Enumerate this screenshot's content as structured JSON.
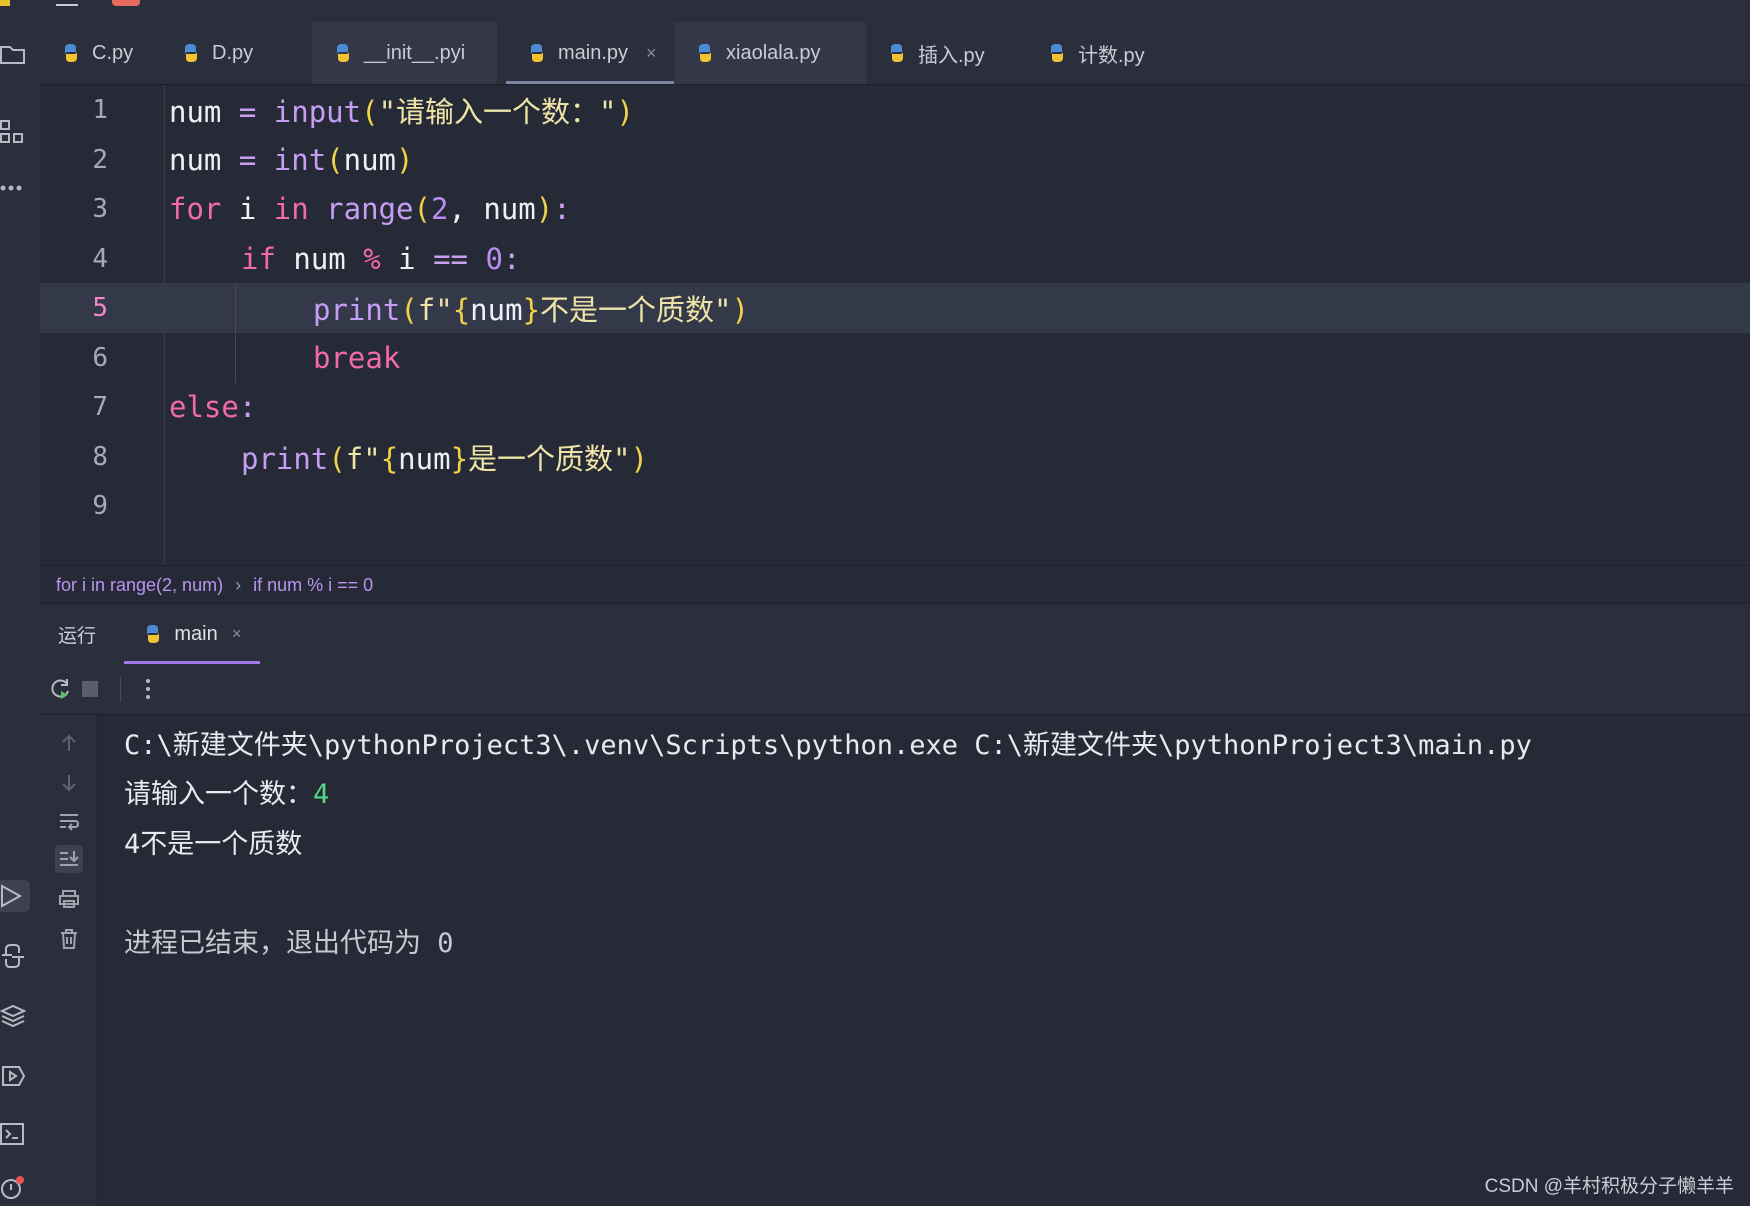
{
  "tabs": [
    {
      "label": "C.py"
    },
    {
      "label": "D.py"
    },
    {
      "label": "__init__.pyi"
    },
    {
      "label": "main.py",
      "close": "×"
    },
    {
      "label": "xiaolala.py"
    },
    {
      "label": "插入.py"
    },
    {
      "label": "计数.py"
    }
  ],
  "editor": {
    "line_numbers": [
      "1",
      "2",
      "3",
      "4",
      "5",
      "6",
      "7",
      "8",
      "9"
    ],
    "current_line": "5",
    "code": {
      "l1": {
        "a": "num",
        "b": " = ",
        "c": "input",
        "d": "(",
        "e": "\"请输入一个数：\"",
        "f": ")"
      },
      "l2": {
        "a": "num",
        "b": " = ",
        "c": "int",
        "d": "(",
        "e": "num",
        "f": ")"
      },
      "l3": {
        "a": "for",
        "b": " i ",
        "c": "in",
        "d": " ",
        "e": "range",
        "f": "(",
        "g": "2",
        "h": ", num",
        "i": ")",
        "j": ":"
      },
      "l4": {
        "a": "if",
        "b": " num ",
        "c": "%",
        "d": " i ",
        "e": "==",
        "f": " ",
        "g": "0",
        "h": ":"
      },
      "l5": {
        "a": "print",
        "b": "(",
        "c": "f\"",
        "d": "{",
        "e": "num",
        "f": "}",
        "g": "不是一个质数\"",
        "h": ")"
      },
      "l6": {
        "a": "break"
      },
      "l7": {
        "a": "else",
        "b": ":"
      },
      "l8": {
        "a": "print",
        "b": "(",
        "c": "f\"",
        "d": "{",
        "e": "num",
        "f": "}",
        "g": "是一个质数\"",
        "h": ")"
      }
    }
  },
  "breadcrumb": {
    "first": "for i in range(2, num)",
    "separator": "›",
    "second": "if num % i == 0"
  },
  "run_panel": {
    "label": "运行",
    "tab": "main",
    "tab_close": "×"
  },
  "console": {
    "command": "C:\\新建文件夹\\pythonProject3\\.venv\\Scripts\\python.exe C:\\新建文件夹\\pythonProject3\\main.py",
    "prompt": "请输入一个数：",
    "input_value": "4",
    "output": "4不是一个质数",
    "exit_message": "进程已结束，退出代码为 0"
  },
  "watermark": "CSDN @羊村积极分子懒羊羊",
  "colors": {
    "background": "#262a36",
    "keyword": "#f26aa6",
    "function": "#c59ef4",
    "bracket": "#f1d247",
    "string": "#efe4a8",
    "number": "#b98cf2",
    "input_value": "#56d88a"
  }
}
